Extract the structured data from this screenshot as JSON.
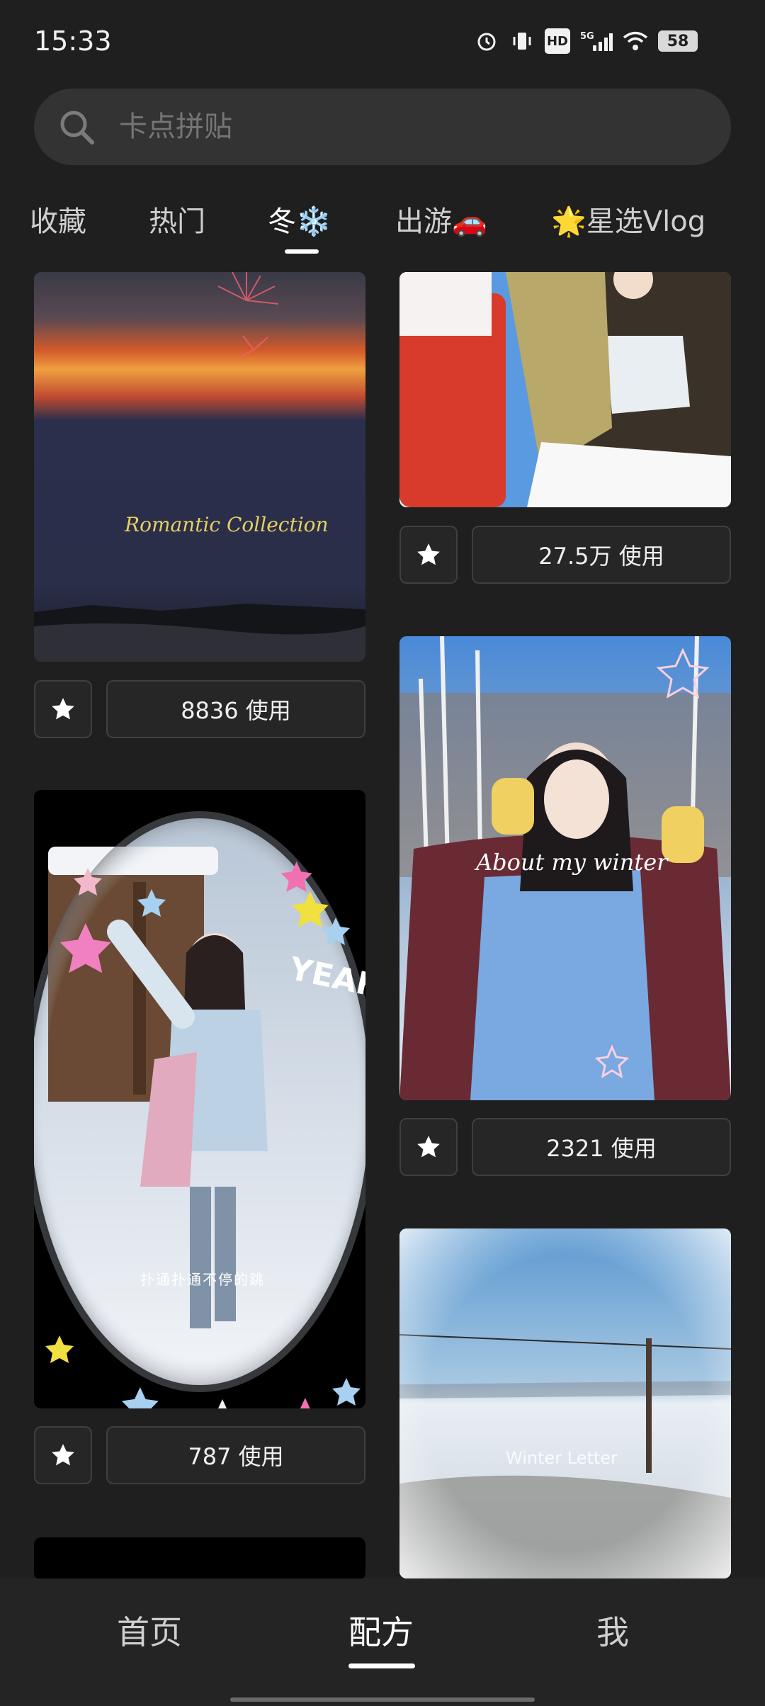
{
  "status_bar": {
    "time": "15:33",
    "network": "5G",
    "hd": "HD",
    "battery": "58"
  },
  "search": {
    "placeholder": "卡点拼贴"
  },
  "tabs": [
    {
      "label": "收藏"
    },
    {
      "label": "热门"
    },
    {
      "label": "冬❄️",
      "active": true
    },
    {
      "label": "出游🚗"
    },
    {
      "label": "🌟星选Vlog"
    }
  ],
  "cards": {
    "left": [
      {
        "overlay_title": "Romantic Collection",
        "usage": "8836 使用"
      },
      {
        "overlay_text": "YEAH",
        "overlay_sub": "扑通扑通不停的跳",
        "usage": "787 使用"
      }
    ],
    "right": [
      {
        "usage": "27.5万 使用"
      },
      {
        "overlay_title": "About my winter",
        "usage": "2321 使用"
      },
      {
        "overlay_title": "Winter Letter"
      }
    ]
  },
  "bottom_nav": {
    "items": [
      {
        "label": "首页"
      },
      {
        "label": "配方",
        "active": true
      },
      {
        "label": "我"
      }
    ]
  },
  "colors": {
    "background": "#1f1f1f",
    "search_bg": "#333333",
    "nav_bg": "#242424",
    "accent": "#ffffff"
  }
}
